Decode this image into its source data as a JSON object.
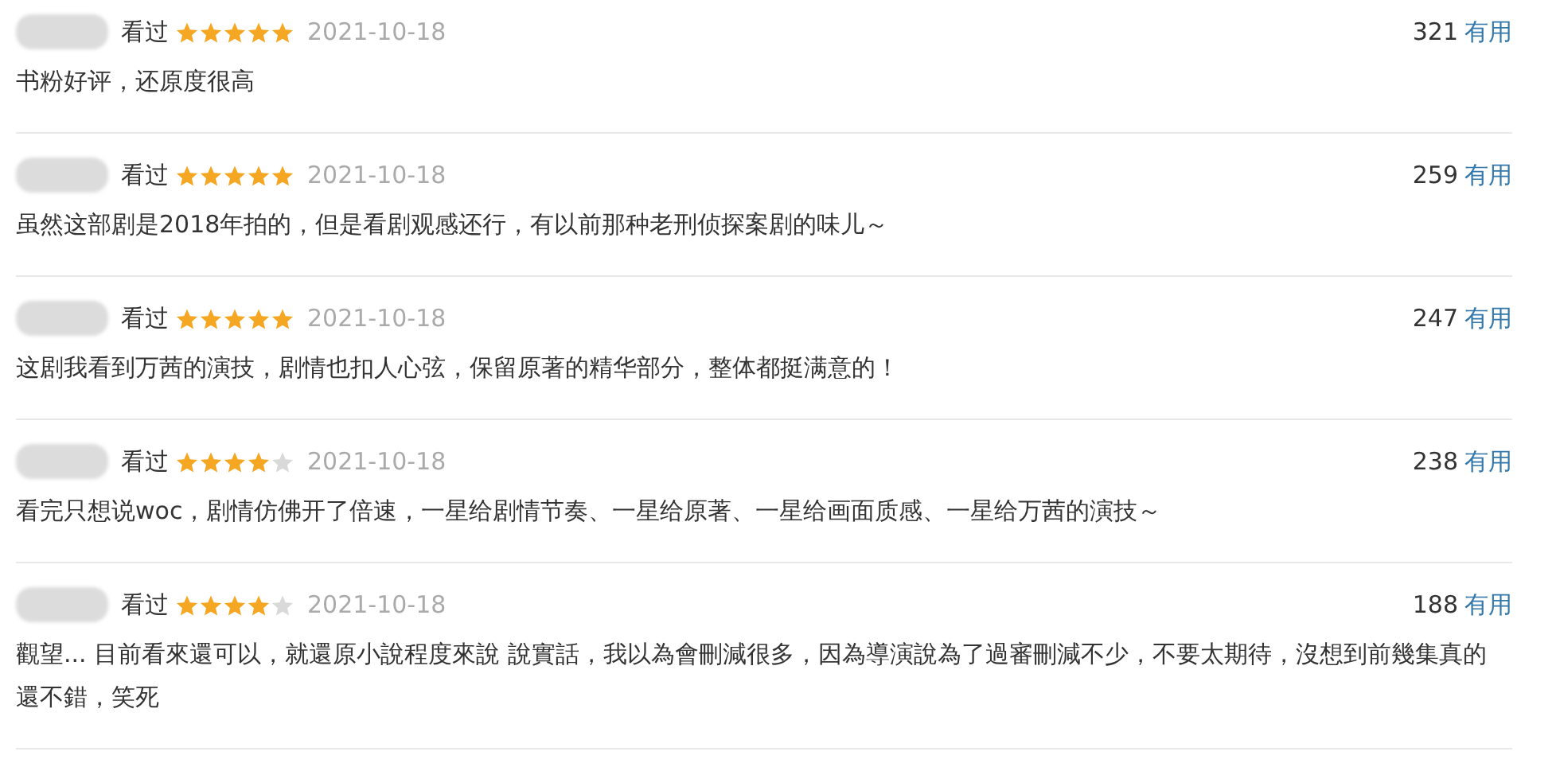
{
  "reviews": [
    {
      "status": "看过",
      "stars": 5,
      "date": "2021-10-18",
      "votes": "321",
      "useful": "有用",
      "text": "书粉好评，还原度很高"
    },
    {
      "status": "看过",
      "stars": 5,
      "date": "2021-10-18",
      "votes": "259",
      "useful": "有用",
      "text": "虽然这部剧是2018年拍的，但是看剧观感还行，有以前那种老刑侦探案剧的味儿～"
    },
    {
      "status": "看过",
      "stars": 5,
      "date": "2021-10-18",
      "votes": "247",
      "useful": "有用",
      "text": "这剧我看到万茜的演技，剧情也扣人心弦，保留原著的精华部分，整体都挺满意的！"
    },
    {
      "status": "看过",
      "stars": 4,
      "date": "2021-10-18",
      "votes": "238",
      "useful": "有用",
      "text": "看完只想说woc，剧情仿佛开了倍速，一星给剧情节奏、一星给原著、一星给画面质感、一星给万茜的演技～"
    },
    {
      "status": "看过",
      "stars": 4,
      "date": "2021-10-18",
      "votes": "188",
      "useful": "有用",
      "text": "觀望... 目前看來還可以，就還原小說程度來說 說實話，我以為會刪減很多，因為導演說為了過審刪減不少，不要太期待，沒想到前幾集真的還不錯，笑死"
    }
  ]
}
